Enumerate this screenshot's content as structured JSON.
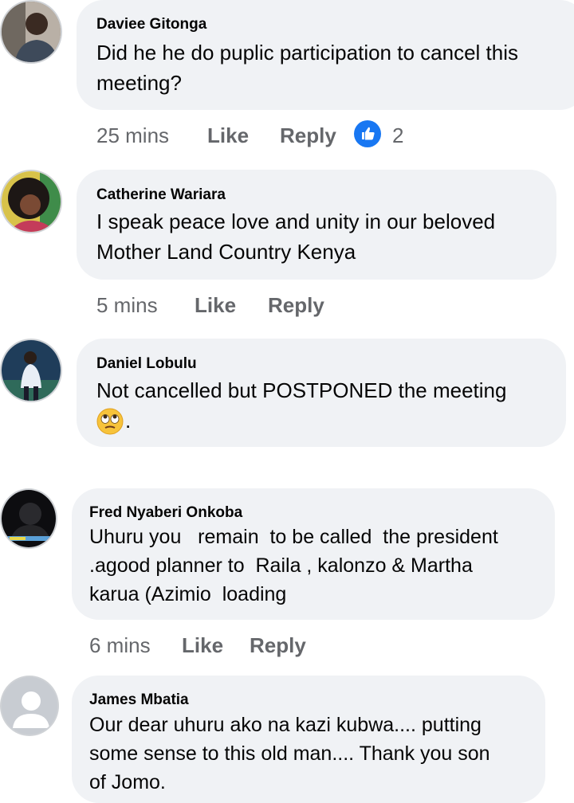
{
  "comments": [
    {
      "author": "Daviee Gitonga",
      "text": "Did he he do puplic participation to cancel this meeting?",
      "line1": "Did he he do puplic participation to cancel this",
      "line2": "meeting?",
      "time": "25 mins",
      "like_label": "Like",
      "reply_label": "Reply",
      "reaction_icon": "thumbs-up-icon",
      "reaction_count": "2"
    },
    {
      "author": "Catherine Wariara",
      "line1": "I speak peace love and unity in our beloved",
      "line2": "Mother Land Country Kenya",
      "time": "5 mins",
      "like_label": "Like",
      "reply_label": "Reply"
    },
    {
      "author": "Daniel Lobulu",
      "line1": "Not cancelled but POSTPONED the meeting",
      "line2_emoji": "face-with-rolling-eyes-icon",
      "line2": "."
    },
    {
      "author": "Fred Nyaberi Onkoba",
      "line1": "Uhuru you   remain  to be called  the president",
      "line2": ".agood planner to  Raila , kalonzo & Martha",
      "line3": "karua (Azimio  loading",
      "time": "6 mins",
      "like_label": "Like",
      "reply_label": "Reply"
    },
    {
      "author": "James Mbatia",
      "line1": "Our dear uhuru ako na kazi kubwa.... putting",
      "line2": "some sense to this old man.... Thank you son",
      "line3": "of Jomo."
    }
  ],
  "colors": {
    "bubble": "#f0f2f5",
    "meta": "#65676b",
    "reaction_blue": "#1877f2",
    "text": "#050505"
  }
}
